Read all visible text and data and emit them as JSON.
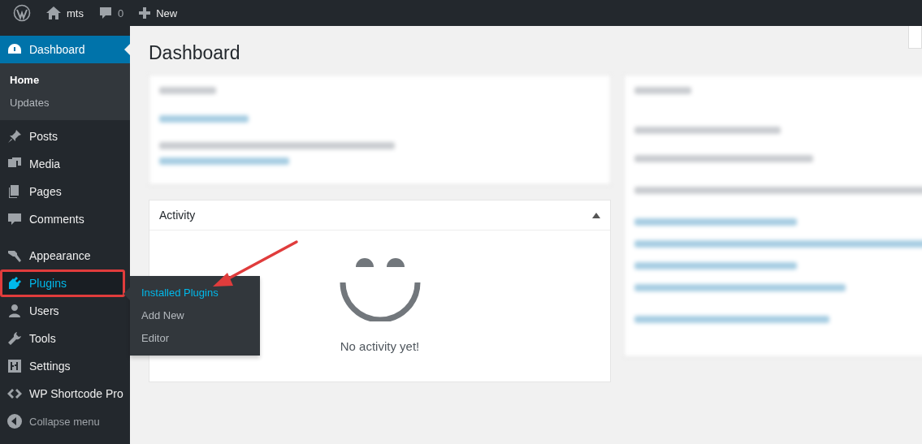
{
  "admin_bar": {
    "site_name": "mts",
    "comments_count": "0",
    "new_label": "New"
  },
  "sidebar": {
    "items": [
      {
        "label": "Dashboard",
        "selected": true,
        "highlighted": false,
        "children": [
          {
            "label": "Home",
            "selected": true
          },
          {
            "label": "Updates",
            "selected": false
          }
        ]
      },
      {
        "label": "Posts",
        "selected": false,
        "highlighted": false
      },
      {
        "label": "Media",
        "selected": false,
        "highlighted": false
      },
      {
        "label": "Pages",
        "selected": false,
        "highlighted": false
      },
      {
        "label": "Comments",
        "selected": false,
        "highlighted": false
      },
      {
        "label": "Appearance",
        "selected": false,
        "highlighted": false
      },
      {
        "label": "Plugins",
        "selected": false,
        "highlighted": true
      },
      {
        "label": "Users",
        "selected": false,
        "highlighted": false
      },
      {
        "label": "Tools",
        "selected": false,
        "highlighted": false
      },
      {
        "label": "Settings",
        "selected": false,
        "highlighted": false
      },
      {
        "label": "WP Shortcode Pro",
        "selected": false,
        "highlighted": false
      }
    ],
    "collapse_label": "Collapse menu"
  },
  "flyout": {
    "items": [
      {
        "label": "Installed Plugins",
        "selected": true
      },
      {
        "label": "Add New",
        "selected": false
      },
      {
        "label": "Editor",
        "selected": false
      }
    ]
  },
  "page_title": "Dashboard",
  "activity": {
    "title": "Activity",
    "empty_message": "No activity yet!"
  }
}
